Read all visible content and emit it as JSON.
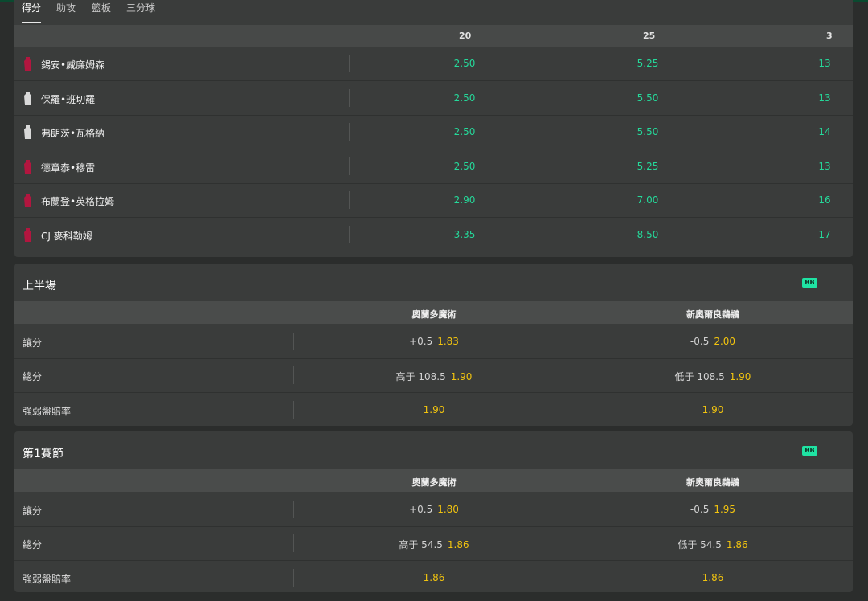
{
  "tabs": [
    "得分",
    "助攻",
    "籃板",
    "三分球"
  ],
  "player_props": {
    "columns": [
      "20",
      "25",
      "3"
    ],
    "players": [
      {
        "name": "錫安•威廉姆森",
        "jersey": "red",
        "odds": [
          "2.50",
          "5.25",
          "13"
        ]
      },
      {
        "name": "保羅•班切羅",
        "jersey": "white",
        "odds": [
          "2.50",
          "5.50",
          "13"
        ]
      },
      {
        "name": "弗朗茨•瓦格納",
        "jersey": "white",
        "odds": [
          "2.50",
          "5.50",
          "14"
        ]
      },
      {
        "name": "德章泰•穆雷",
        "jersey": "red",
        "odds": [
          "2.50",
          "5.25",
          "13"
        ]
      },
      {
        "name": "布蘭登•英格拉姆",
        "jersey": "red",
        "odds": [
          "2.90",
          "7.00",
          "16"
        ]
      },
      {
        "name": "CJ 麥科勒姆",
        "jersey": "red",
        "odds": [
          "3.35",
          "8.50",
          "17"
        ]
      }
    ]
  },
  "markets": [
    {
      "title": "上半場",
      "badge": "BB",
      "teams": [
        "奧蘭多魔術",
        "新奧爾良鵜鶘"
      ],
      "rows": [
        {
          "label": "讓分",
          "home_line": "+0.5",
          "home_price": "1.83",
          "away_line": "-0.5",
          "away_price": "2.00"
        },
        {
          "label": "總分",
          "home_line": "高于 108.5",
          "home_price": "1.90",
          "away_line": "低于 108.5",
          "away_price": "1.90"
        },
        {
          "label": "強弱盤賠率",
          "home_line": "",
          "home_price": "1.90",
          "away_line": "",
          "away_price": "1.90"
        }
      ]
    },
    {
      "title": "第1賽節",
      "badge": "BB",
      "teams": [
        "奧蘭多魔術",
        "新奧爾良鵜鶘"
      ],
      "rows": [
        {
          "label": "讓分",
          "home_line": "+0.5",
          "home_price": "1.80",
          "away_line": "-0.5",
          "away_price": "1.95"
        },
        {
          "label": "總分",
          "home_line": "高于 54.5",
          "home_price": "1.86",
          "away_line": "低于 54.5",
          "away_price": "1.86"
        },
        {
          "label": "強弱盤賠率",
          "home_line": "",
          "home_price": "1.86",
          "away_line": "",
          "away_price": "1.86"
        }
      ]
    }
  ],
  "colors": {
    "accent": "#20e3a0",
    "odds_green": "#25d99a",
    "price_yellow": "#f2c40f",
    "jersey_red": "#b2163f",
    "jersey_white": "#d9d9d9"
  }
}
